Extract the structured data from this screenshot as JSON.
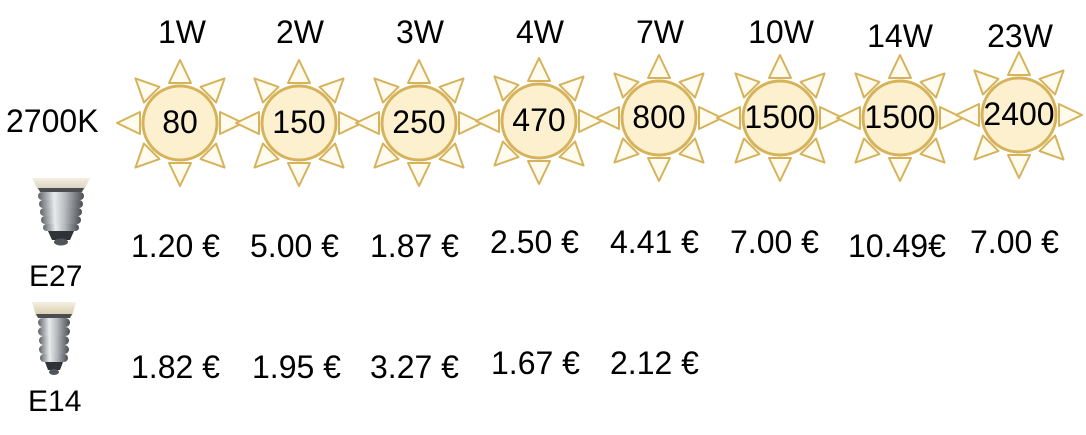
{
  "color_temperature": "2700K",
  "colors": {
    "sun_fill": "#FCF0CE",
    "sun_stroke": "#D6B25A",
    "ray_fill": "#FFFBEF"
  },
  "columns": [
    {
      "watt": "1W",
      "lumen": "80"
    },
    {
      "watt": "2W",
      "lumen": "150"
    },
    {
      "watt": "3W",
      "lumen": "250"
    },
    {
      "watt": "4W",
      "lumen": "470"
    },
    {
      "watt": "7W",
      "lumen": "800"
    },
    {
      "watt": "10W",
      "lumen": "1500"
    },
    {
      "watt": "14W",
      "lumen": "1500"
    },
    {
      "watt": "23W",
      "lumen": "2400"
    }
  ],
  "sockets": [
    {
      "label": "E27",
      "icon": "e27-bulb-socket-icon",
      "prices": [
        "1.20 €",
        "5.00 €",
        "1.87 €",
        "2.50 €",
        "4.41 €",
        "7.00 €",
        "10.49€",
        "7.00 €"
      ]
    },
    {
      "label": "E14",
      "icon": "e14-bulb-socket-icon",
      "prices": [
        "1.82 €",
        "1.95 €",
        "3.27 €",
        "1.67 €",
        "2.12 €"
      ]
    }
  ]
}
